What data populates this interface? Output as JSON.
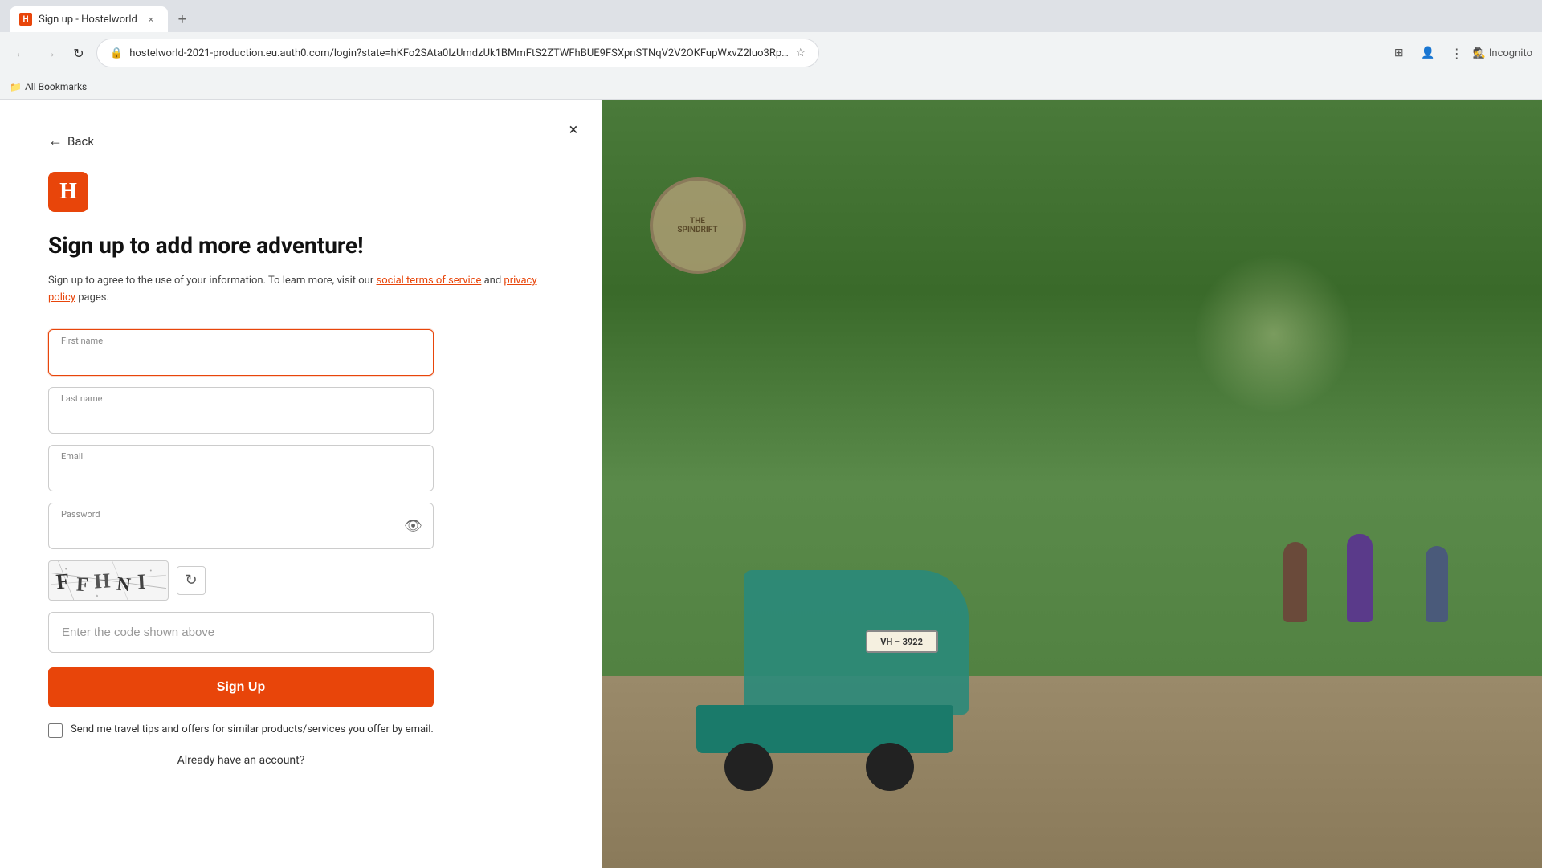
{
  "browser": {
    "tab_title": "Sign up - Hostelworld",
    "url": "hostelworld-2021-production.eu.auth0.com/login?state=hKFo2SAta0lzUmdzUk1BMmFtS2ZTWFhBUE9FSXpnSTNqV2V2OKFupWxvZ2luo3RpZNkgSXA3LThHWF9jdmtRU3dJVkFuOFkxdzNNOWdHRDJPLVSjY2Ik2SB1MDFlcDljdU9YWG1tcTg4WGZSRFo...",
    "incognito_text": "Incognito",
    "bookmarks_label": "All Bookmarks",
    "new_tab_label": "+"
  },
  "page": {
    "back_label": "Back",
    "close_label": "×",
    "logo_letter": "H",
    "heading": "Sign up to add more adventure!",
    "description_text": "Sign up to agree to the use of your information. To learn more, visit our",
    "description_link1": "social terms of service",
    "description_and": "and",
    "description_link2": "privacy policy",
    "description_end": "pages.",
    "first_name_label": "First name",
    "first_name_placeholder": "",
    "last_name_label": "Last name",
    "last_name_placeholder": "",
    "email_label": "Email",
    "email_placeholder": "",
    "password_label": "Password",
    "password_placeholder": "",
    "captcha_text": "FFHNI",
    "captcha_refresh_icon": "↻",
    "captcha_input_placeholder": "Enter the code shown above",
    "signup_button_label": "Sign Up",
    "checkbox_label": "Send me travel tips and offers for similar products/services you offer by email.",
    "already_account_text": "Already have an account?",
    "already_account_link": ""
  },
  "colors": {
    "brand_orange": "#e8450a",
    "text_dark": "#111111",
    "text_medium": "#444444",
    "text_light": "#888888",
    "border_default": "#cccccc",
    "bg_white": "#ffffff"
  }
}
